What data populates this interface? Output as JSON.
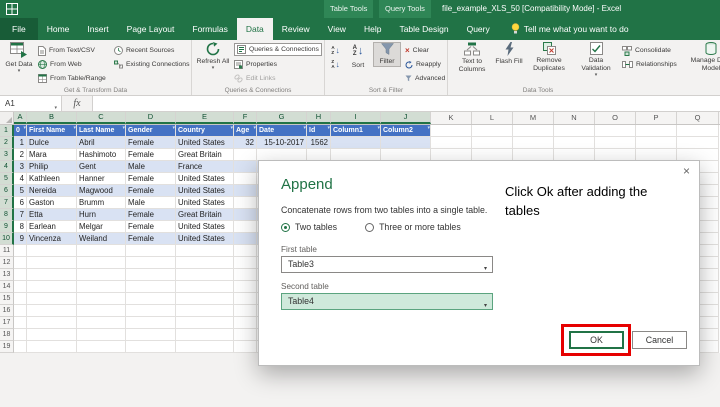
{
  "title_bar": {
    "contextual_table_tools": "Table Tools",
    "contextual_query_tools": "Query Tools",
    "filename": "file_example_XLS_50  [Compatibility Mode] - Excel"
  },
  "tabs": {
    "file": "File",
    "home": "Home",
    "insert": "Insert",
    "page_layout": "Page Layout",
    "formulas": "Formulas",
    "data": "Data",
    "review": "Review",
    "view": "View",
    "help": "Help",
    "table_design": "Table Design",
    "query": "Query",
    "tell_me": "Tell me what you want to do"
  },
  "ribbon": {
    "get_data": "Get Data",
    "from_text_csv": "From Text/CSV",
    "from_web": "From Web",
    "from_table_range": "From Table/Range",
    "recent_sources": "Recent Sources",
    "existing_connections": "Existing Connections",
    "group_get_transform": "Get & Transform Data",
    "refresh_all": "Refresh All",
    "queries_connections": "Queries & Connections",
    "properties": "Properties",
    "edit_links": "Edit Links",
    "group_queries_connections": "Queries & Connections",
    "sort": "Sort",
    "filter": "Filter",
    "clear": "Clear",
    "reapply": "Reapply",
    "advanced": "Advanced",
    "group_sort_filter": "Sort & Filter",
    "text_to_columns": "Text to Columns",
    "flash_fill": "Flash Fill",
    "remove_duplicates": "Remove Duplicates",
    "data_validation": "Data Validation",
    "consolidate": "Consolidate",
    "relationships": "Relationships",
    "manage_data_model": "Manage Data Model",
    "group_data_tools": "Data Tools"
  },
  "formula_bar": {
    "name_box": "A1",
    "fx_label": "fx",
    "formula_value": ""
  },
  "sheet": {
    "columns": [
      "A",
      "B",
      "C",
      "D",
      "E",
      "F",
      "G",
      "H",
      "I",
      "J",
      "K",
      "L",
      "M",
      "N",
      "O",
      "P",
      "Q"
    ],
    "rows_visible": 19,
    "selection": {
      "highlighted_columns": 10,
      "highlighted_rows": 10
    },
    "table": {
      "headers": [
        "0",
        "First Name",
        "Last Name",
        "Gender",
        "Country",
        "Age",
        "Date",
        "Id",
        "Column1",
        "Column2"
      ],
      "rows": [
        [
          "1",
          "Dulce",
          "Abril",
          "Female",
          "United States",
          "32",
          "15-10-2017",
          "1562",
          "",
          ""
        ],
        [
          "2",
          "Mara",
          "Hashimoto",
          "Female",
          "Great Britain",
          "",
          "",
          "",
          "",
          ""
        ],
        [
          "3",
          "Philip",
          "Gent",
          "Male",
          "France",
          "",
          "",
          "",
          "",
          ""
        ],
        [
          "4",
          "Kathleen",
          "Hanner",
          "Female",
          "United States",
          "",
          "",
          "",
          "",
          ""
        ],
        [
          "5",
          "Nereida",
          "Magwood",
          "Female",
          "United States",
          "",
          "",
          "",
          "",
          ""
        ],
        [
          "6",
          "Gaston",
          "Brumm",
          "Male",
          "United States",
          "",
          "",
          "",
          "",
          ""
        ],
        [
          "7",
          "Etta",
          "Hurn",
          "Female",
          "Great Britain",
          "",
          "",
          "",
          "",
          ""
        ],
        [
          "8",
          "Earlean",
          "Melgar",
          "Female",
          "United States",
          "",
          "",
          "",
          "",
          ""
        ],
        [
          "9",
          "Vincenza",
          "Weiland",
          "Female",
          "United States",
          "",
          "",
          "",
          "",
          ""
        ]
      ]
    }
  },
  "dialog": {
    "title": "Append",
    "description": "Concatenate rows from two tables into a single table.",
    "radio_two": "Two tables",
    "radio_three": "Three or more tables",
    "first_table_label": "First table",
    "first_table_value": "Table3",
    "second_table_label": "Second table",
    "second_table_value": "Table4",
    "ok_label": "OK",
    "cancel_label": "Cancel"
  },
  "annotation": {
    "note": "Click Ok after adding the tables"
  },
  "icons": {
    "close": "×",
    "caret": "▾",
    "down_arrow": "↓",
    "sort_a": "A",
    "sort_z": "Z",
    "clear_x": "×"
  },
  "colors": {
    "excel_green": "#217346",
    "table_header_blue": "#4472C4",
    "band_blue": "#D9E2F3",
    "annotation_red": "#E60000",
    "second_table_highlight": "#CFE9DB"
  }
}
